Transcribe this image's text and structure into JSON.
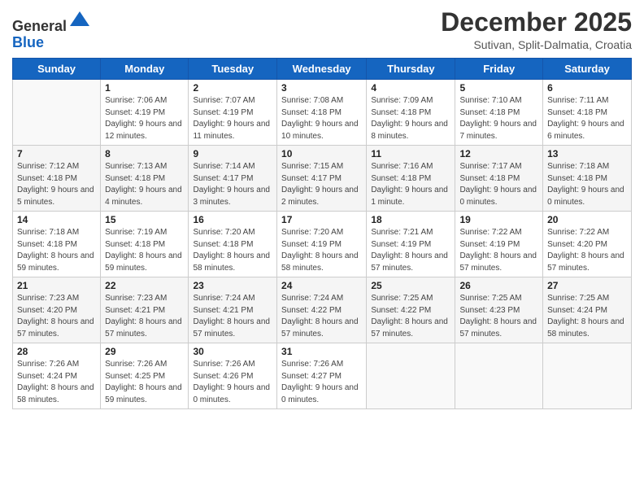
{
  "logo": {
    "general": "General",
    "blue": "Blue"
  },
  "header": {
    "month": "December 2025",
    "location": "Sutivan, Split-Dalmatia, Croatia"
  },
  "days_of_week": [
    "Sunday",
    "Monday",
    "Tuesday",
    "Wednesday",
    "Thursday",
    "Friday",
    "Saturday"
  ],
  "weeks": [
    [
      {
        "day": "",
        "sunrise": "",
        "sunset": "",
        "daylight": ""
      },
      {
        "day": "1",
        "sunrise": "Sunrise: 7:06 AM",
        "sunset": "Sunset: 4:19 PM",
        "daylight": "Daylight: 9 hours and 12 minutes."
      },
      {
        "day": "2",
        "sunrise": "Sunrise: 7:07 AM",
        "sunset": "Sunset: 4:19 PM",
        "daylight": "Daylight: 9 hours and 11 minutes."
      },
      {
        "day": "3",
        "sunrise": "Sunrise: 7:08 AM",
        "sunset": "Sunset: 4:18 PM",
        "daylight": "Daylight: 9 hours and 10 minutes."
      },
      {
        "day": "4",
        "sunrise": "Sunrise: 7:09 AM",
        "sunset": "Sunset: 4:18 PM",
        "daylight": "Daylight: 9 hours and 8 minutes."
      },
      {
        "day": "5",
        "sunrise": "Sunrise: 7:10 AM",
        "sunset": "Sunset: 4:18 PM",
        "daylight": "Daylight: 9 hours and 7 minutes."
      },
      {
        "day": "6",
        "sunrise": "Sunrise: 7:11 AM",
        "sunset": "Sunset: 4:18 PM",
        "daylight": "Daylight: 9 hours and 6 minutes."
      }
    ],
    [
      {
        "day": "7",
        "sunrise": "Sunrise: 7:12 AM",
        "sunset": "Sunset: 4:18 PM",
        "daylight": "Daylight: 9 hours and 5 minutes."
      },
      {
        "day": "8",
        "sunrise": "Sunrise: 7:13 AM",
        "sunset": "Sunset: 4:18 PM",
        "daylight": "Daylight: 9 hours and 4 minutes."
      },
      {
        "day": "9",
        "sunrise": "Sunrise: 7:14 AM",
        "sunset": "Sunset: 4:17 PM",
        "daylight": "Daylight: 9 hours and 3 minutes."
      },
      {
        "day": "10",
        "sunrise": "Sunrise: 7:15 AM",
        "sunset": "Sunset: 4:17 PM",
        "daylight": "Daylight: 9 hours and 2 minutes."
      },
      {
        "day": "11",
        "sunrise": "Sunrise: 7:16 AM",
        "sunset": "Sunset: 4:18 PM",
        "daylight": "Daylight: 9 hours and 1 minute."
      },
      {
        "day": "12",
        "sunrise": "Sunrise: 7:17 AM",
        "sunset": "Sunset: 4:18 PM",
        "daylight": "Daylight: 9 hours and 0 minutes."
      },
      {
        "day": "13",
        "sunrise": "Sunrise: 7:18 AM",
        "sunset": "Sunset: 4:18 PM",
        "daylight": "Daylight: 9 hours and 0 minutes."
      }
    ],
    [
      {
        "day": "14",
        "sunrise": "Sunrise: 7:18 AM",
        "sunset": "Sunset: 4:18 PM",
        "daylight": "Daylight: 8 hours and 59 minutes."
      },
      {
        "day": "15",
        "sunrise": "Sunrise: 7:19 AM",
        "sunset": "Sunset: 4:18 PM",
        "daylight": "Daylight: 8 hours and 59 minutes."
      },
      {
        "day": "16",
        "sunrise": "Sunrise: 7:20 AM",
        "sunset": "Sunset: 4:18 PM",
        "daylight": "Daylight: 8 hours and 58 minutes."
      },
      {
        "day": "17",
        "sunrise": "Sunrise: 7:20 AM",
        "sunset": "Sunset: 4:19 PM",
        "daylight": "Daylight: 8 hours and 58 minutes."
      },
      {
        "day": "18",
        "sunrise": "Sunrise: 7:21 AM",
        "sunset": "Sunset: 4:19 PM",
        "daylight": "Daylight: 8 hours and 57 minutes."
      },
      {
        "day": "19",
        "sunrise": "Sunrise: 7:22 AM",
        "sunset": "Sunset: 4:19 PM",
        "daylight": "Daylight: 8 hours and 57 minutes."
      },
      {
        "day": "20",
        "sunrise": "Sunrise: 7:22 AM",
        "sunset": "Sunset: 4:20 PM",
        "daylight": "Daylight: 8 hours and 57 minutes."
      }
    ],
    [
      {
        "day": "21",
        "sunrise": "Sunrise: 7:23 AM",
        "sunset": "Sunset: 4:20 PM",
        "daylight": "Daylight: 8 hours and 57 minutes."
      },
      {
        "day": "22",
        "sunrise": "Sunrise: 7:23 AM",
        "sunset": "Sunset: 4:21 PM",
        "daylight": "Daylight: 8 hours and 57 minutes."
      },
      {
        "day": "23",
        "sunrise": "Sunrise: 7:24 AM",
        "sunset": "Sunset: 4:21 PM",
        "daylight": "Daylight: 8 hours and 57 minutes."
      },
      {
        "day": "24",
        "sunrise": "Sunrise: 7:24 AM",
        "sunset": "Sunset: 4:22 PM",
        "daylight": "Daylight: 8 hours and 57 minutes."
      },
      {
        "day": "25",
        "sunrise": "Sunrise: 7:25 AM",
        "sunset": "Sunset: 4:22 PM",
        "daylight": "Daylight: 8 hours and 57 minutes."
      },
      {
        "day": "26",
        "sunrise": "Sunrise: 7:25 AM",
        "sunset": "Sunset: 4:23 PM",
        "daylight": "Daylight: 8 hours and 57 minutes."
      },
      {
        "day": "27",
        "sunrise": "Sunrise: 7:25 AM",
        "sunset": "Sunset: 4:24 PM",
        "daylight": "Daylight: 8 hours and 58 minutes."
      }
    ],
    [
      {
        "day": "28",
        "sunrise": "Sunrise: 7:26 AM",
        "sunset": "Sunset: 4:24 PM",
        "daylight": "Daylight: 8 hours and 58 minutes."
      },
      {
        "day": "29",
        "sunrise": "Sunrise: 7:26 AM",
        "sunset": "Sunset: 4:25 PM",
        "daylight": "Daylight: 8 hours and 59 minutes."
      },
      {
        "day": "30",
        "sunrise": "Sunrise: 7:26 AM",
        "sunset": "Sunset: 4:26 PM",
        "daylight": "Daylight: 9 hours and 0 minutes."
      },
      {
        "day": "31",
        "sunrise": "Sunrise: 7:26 AM",
        "sunset": "Sunset: 4:27 PM",
        "daylight": "Daylight: 9 hours and 0 minutes."
      },
      {
        "day": "",
        "sunrise": "",
        "sunset": "",
        "daylight": ""
      },
      {
        "day": "",
        "sunrise": "",
        "sunset": "",
        "daylight": ""
      },
      {
        "day": "",
        "sunrise": "",
        "sunset": "",
        "daylight": ""
      }
    ]
  ]
}
